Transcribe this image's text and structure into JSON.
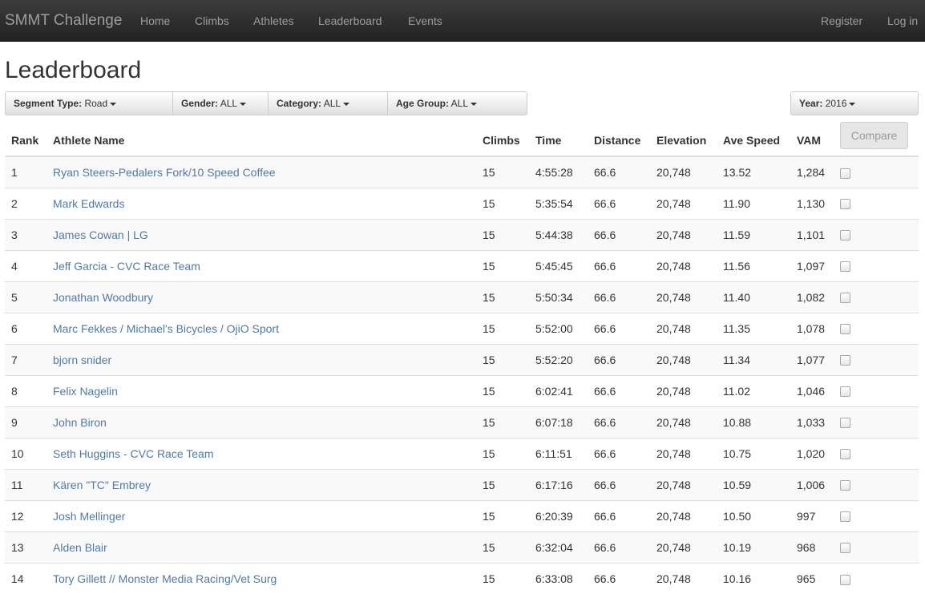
{
  "nav": {
    "brand": "SMMT Challenge",
    "links": [
      "Home",
      "Climbs",
      "Athletes",
      "Leaderboard",
      "Events"
    ],
    "right_links": [
      "Register",
      "Log in"
    ]
  },
  "page": {
    "title": "Leaderboard"
  },
  "filters": {
    "segment_type": {
      "label": "Segment Type:",
      "value": "Road"
    },
    "gender": {
      "label": "Gender:",
      "value": "ALL"
    },
    "category": {
      "label": "Category:",
      "value": "ALL"
    },
    "age_group": {
      "label": "Age Group:",
      "value": "ALL"
    },
    "year": {
      "label": "Year:",
      "value": "2016"
    }
  },
  "compare_label": "Compare",
  "table": {
    "headers": [
      "Rank",
      "Athlete Name",
      "Climbs",
      "Time",
      "Distance",
      "Elevation",
      "Ave Speed",
      "VAM"
    ],
    "rows": [
      [
        "1",
        "Ryan Steers-Pedalers Fork/10 Speed Coffee",
        "15",
        "4:55:28",
        "66.6",
        "20,748",
        "13.52",
        "1,284"
      ],
      [
        "2",
        "Mark Edwards",
        "15",
        "5:35:54",
        "66.6",
        "20,748",
        "11.90",
        "1,130"
      ],
      [
        "3",
        "James Cowan | LG",
        "15",
        "5:44:38",
        "66.6",
        "20,748",
        "11.59",
        "1,101"
      ],
      [
        "4",
        "Jeff Garcia - CVC Race Team",
        "15",
        "5:45:45",
        "66.6",
        "20,748",
        "11.56",
        "1,097"
      ],
      [
        "5",
        "Jonathan Woodbury",
        "15",
        "5:50:34",
        "66.6",
        "20,748",
        "11.40",
        "1,082"
      ],
      [
        "6",
        "Marc Fekkes / Michael's Bicycles / OjiO Sport",
        "15",
        "5:52:00",
        "66.6",
        "20,748",
        "11.35",
        "1,078"
      ],
      [
        "7",
        "bjorn snider",
        "15",
        "5:52:20",
        "66.6",
        "20,748",
        "11.34",
        "1,077"
      ],
      [
        "8",
        "Felix Nagelin",
        "15",
        "6:02:41",
        "66.6",
        "20,748",
        "11.02",
        "1,046"
      ],
      [
        "9",
        "John Biron",
        "15",
        "6:07:18",
        "66.6",
        "20,748",
        "10.88",
        "1,033"
      ],
      [
        "10",
        "Seth Huggins - CVC Race Team",
        "15",
        "6:11:51",
        "66.6",
        "20,748",
        "10.75",
        "1,020"
      ],
      [
        "11",
        "Kären \"TC\" Embrey",
        "15",
        "6:17:16",
        "66.6",
        "20,748",
        "10.59",
        "1,006"
      ],
      [
        "12",
        "Josh Mellinger",
        "15",
        "6:20:39",
        "66.6",
        "20,748",
        "10.50",
        "997"
      ],
      [
        "13",
        "Alden Blair",
        "15",
        "6:32:04",
        "66.6",
        "20,748",
        "10.19",
        "968"
      ],
      [
        "14",
        "Tory Gillett // Monster Media Racing/Vet Surg",
        "15",
        "6:33:08",
        "66.6",
        "20,748",
        "10.16",
        "965"
      ]
    ]
  }
}
